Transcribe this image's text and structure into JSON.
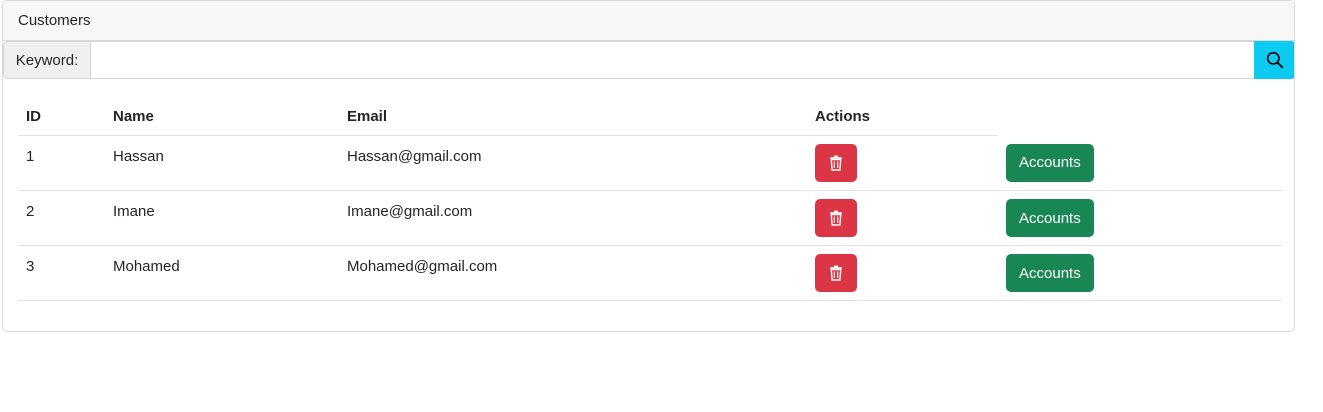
{
  "card": {
    "title": "Customers"
  },
  "search": {
    "label": "Keyword:",
    "value": "",
    "placeholder": ""
  },
  "table": {
    "headers": {
      "id": "ID",
      "name": "Name",
      "email": "Email",
      "actions": "Actions"
    },
    "rows": [
      {
        "id": "1",
        "name": "Hassan",
        "email": "Hassan@gmail.com",
        "accounts_label": "Accounts"
      },
      {
        "id": "2",
        "name": "Imane",
        "email": "Imane@gmail.com",
        "accounts_label": "Accounts"
      },
      {
        "id": "3",
        "name": "Mohamed",
        "email": "Mohamed@gmail.com",
        "accounts_label": "Accounts"
      }
    ]
  },
  "icons": {
    "search": "search-icon",
    "delete": "trash-icon"
  },
  "colors": {
    "search_button": "#0dcaf0",
    "delete_button": "#dc3545",
    "accounts_button": "#198754"
  }
}
